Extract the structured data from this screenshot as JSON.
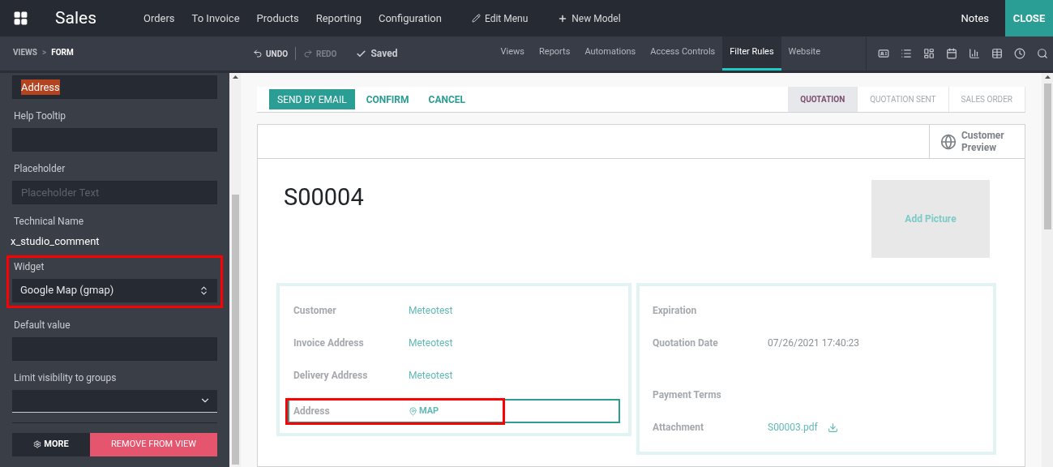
{
  "topbar": {
    "app": "Sales",
    "menu": [
      "Orders",
      "To Invoice",
      "Products",
      "Reporting",
      "Configuration"
    ],
    "edit_menu": "Edit Menu",
    "new_model": "New Model",
    "notes": "Notes",
    "close": "CLOSE"
  },
  "toolbar": {
    "breadcrumb": [
      {
        "label": "VIEWS",
        "selected": false
      },
      {
        "label": "FORM",
        "selected": true
      }
    ],
    "separator": ">",
    "undo": "UNDO",
    "redo": "REDO",
    "saved": "Saved",
    "tabs": [
      {
        "label": "Views",
        "selected": false
      },
      {
        "label": "Reports",
        "selected": false
      },
      {
        "label": "Automations",
        "selected": false
      },
      {
        "label": "Access Controls",
        "selected": false
      },
      {
        "label": "Filter Rules",
        "selected": true
      },
      {
        "label": "Website",
        "selected": false
      }
    ]
  },
  "sidebar": {
    "fields": [
      {
        "kind": "input",
        "value": "Address",
        "text_selected": true
      },
      {
        "kind": "input",
        "label": "Help Tooltip"
      },
      {
        "kind": "input",
        "label": "Placeholder",
        "placeholder": "Placeholder Text"
      },
      {
        "kind": "text",
        "label": "Technical Name",
        "value": "x_studio_comment"
      },
      {
        "kind": "select",
        "label": "Widget",
        "value": "Google Map (gmap)",
        "highlighted": true
      },
      {
        "kind": "input",
        "label": "Default value"
      },
      {
        "kind": "dropdown",
        "label": "Limit visibility to groups"
      }
    ],
    "more": "MORE",
    "remove": "REMOVE FROM VIEW"
  },
  "form": {
    "actions": [
      {
        "label": "SEND BY EMAIL",
        "primary": true
      },
      {
        "label": "CONFIRM",
        "primary": false
      },
      {
        "label": "CANCEL",
        "primary": false
      }
    ],
    "steps": [
      {
        "label": "QUOTATION",
        "selected": true
      },
      {
        "label": "QUOTATION SENT",
        "selected": false
      },
      {
        "label": "SALES ORDER",
        "selected": false
      }
    ],
    "preview": "Customer Preview",
    "title": "S00004",
    "add_picture": "Add Picture",
    "left": [
      {
        "label": "Customer",
        "kind": "link",
        "value": "Meteotest",
        "highlighted": false
      },
      {
        "label": "Invoice Address",
        "kind": "link",
        "value": "Meteotest",
        "highlighted": false
      },
      {
        "label": "Delivery Address",
        "kind": "link",
        "value": "Meteotest",
        "highlighted": false
      },
      {
        "label": "Address",
        "kind": "map",
        "value": "MAP",
        "highlighted": true
      }
    ],
    "right": [
      {
        "label": "Expiration",
        "kind": "empty"
      },
      {
        "label": "Quotation Date",
        "kind": "text",
        "value": "07/26/2021 17:40:23"
      },
      {
        "label": "Payment Terms",
        "kind": "empty"
      },
      {
        "label": "Attachment",
        "kind": "file",
        "value": "S00003.pdf"
      }
    ]
  }
}
